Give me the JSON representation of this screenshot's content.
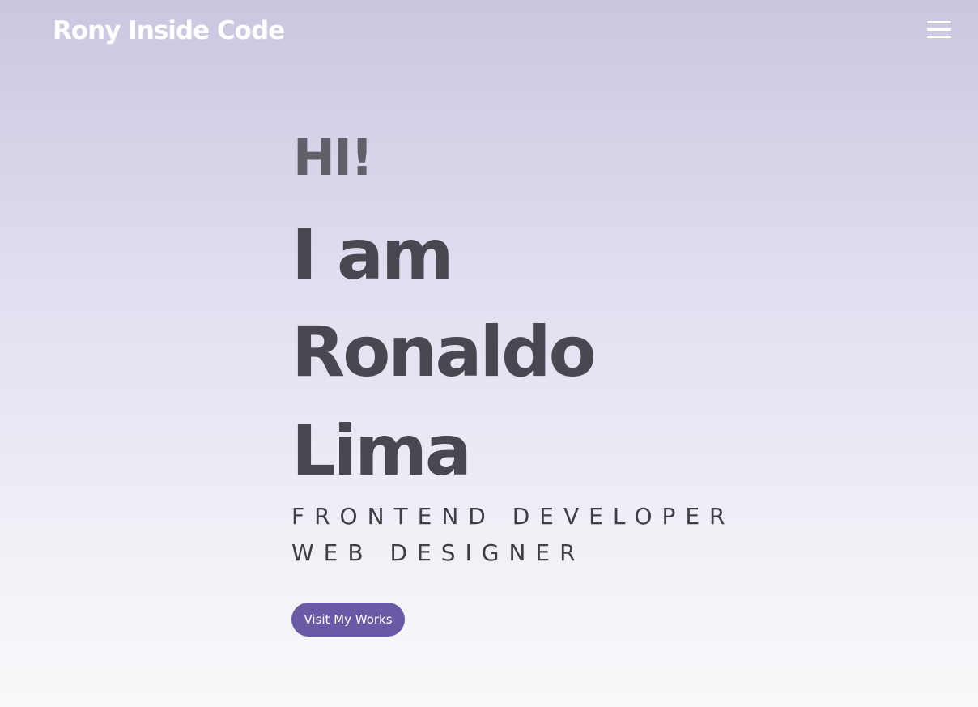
{
  "nav": {
    "logo": "Rony Inside Code",
    "menu_icon": "hamburger-menu-icon"
  },
  "hero": {
    "greeting": "HI!",
    "name_lines": [
      "I am",
      "Ronaldo",
      "Lima"
    ],
    "roles": [
      "FRONTEND DEVELOPER",
      "WEB DESIGNER"
    ],
    "button_label": "Visit My Works"
  },
  "colors": {
    "accent": "#6a5aa6",
    "heading": "#484950",
    "greeting": "#606068",
    "background_top": "#cbc6e0",
    "background_bottom": "#f9f9fb"
  }
}
